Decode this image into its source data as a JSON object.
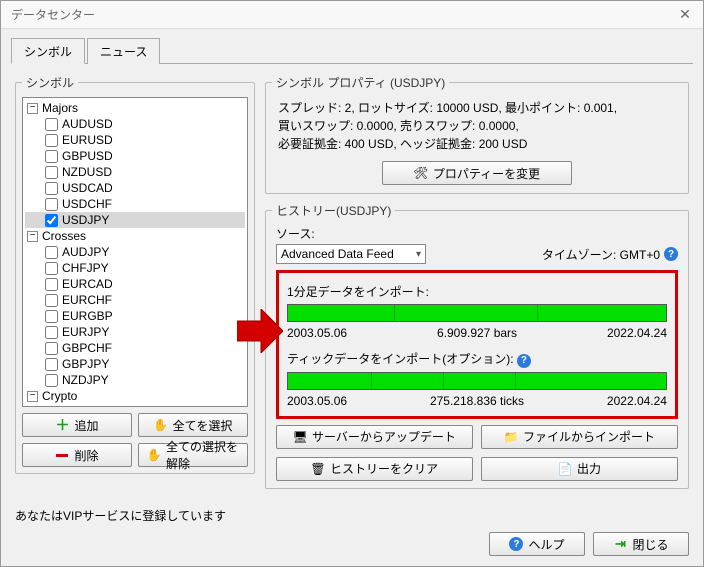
{
  "window": {
    "title": "データセンター"
  },
  "tabs": [
    {
      "label": "シンボル",
      "active": true
    },
    {
      "label": "ニュース",
      "active": false
    }
  ],
  "symbolPanel": {
    "legend": "シンボル",
    "groups": [
      {
        "name": "Majors",
        "items": [
          {
            "label": "AUDUSD",
            "checked": false
          },
          {
            "label": "EURUSD",
            "checked": false
          },
          {
            "label": "GBPUSD",
            "checked": false
          },
          {
            "label": "NZDUSD",
            "checked": false
          },
          {
            "label": "USDCAD",
            "checked": false
          },
          {
            "label": "USDCHF",
            "checked": false
          },
          {
            "label": "USDJPY",
            "checked": true,
            "selected": true
          }
        ]
      },
      {
        "name": "Crosses",
        "items": [
          {
            "label": "AUDJPY",
            "checked": false
          },
          {
            "label": "CHFJPY",
            "checked": false
          },
          {
            "label": "EURCAD",
            "checked": false
          },
          {
            "label": "EURCHF",
            "checked": false
          },
          {
            "label": "EURGBP",
            "checked": false
          },
          {
            "label": "EURJPY",
            "checked": false
          },
          {
            "label": "GBPCHF",
            "checked": false
          },
          {
            "label": "GBPJPY",
            "checked": false
          },
          {
            "label": "NZDJPY",
            "checked": false
          }
        ]
      },
      {
        "name": "Crypto",
        "items": []
      }
    ],
    "buttons": {
      "add": "追加",
      "selectAll": "全てを選択",
      "delete": "削除",
      "deselectAll": "全ての選択を解除"
    }
  },
  "propsPanel": {
    "legend": "シンボル プロパティ (USDJPY)",
    "line1": "スプレッド: 2, ロットサイズ: 10000 USD, 最小ポイント: 0.001,",
    "line2": "買いスワップ: 0.0000, 売りスワップ: 0.0000,",
    "line3": "必要証拠金: 400 USD, ヘッジ証拠金: 200 USD",
    "changeBtn": "プロパティーを変更"
  },
  "historyPanel": {
    "legend": "ヒストリー(USDJPY)",
    "sourceLabel": "ソース:",
    "sourceValue": "Advanced Data Feed",
    "timezoneLabel": "タイムゾーン: GMT+0",
    "import1": {
      "title": "1分足データをインポート:",
      "start": "2003.05.06",
      "count": "6.909.927 bars",
      "end": "2022.04.24"
    },
    "import2": {
      "title": "ティックデータをインポート(オプション):",
      "start": "2003.05.06",
      "count": "275.218.836 ticks",
      "end": "2022.04.24"
    },
    "buttons": {
      "updateServer": "サーバーからアップデート",
      "importFile": "ファイルからインポート",
      "clearHistory": "ヒストリーをクリア",
      "export": "出力"
    }
  },
  "footer": {
    "status": "あなたはVIPサービスに登録しています",
    "help": "ヘルプ",
    "close": "閉じる"
  }
}
